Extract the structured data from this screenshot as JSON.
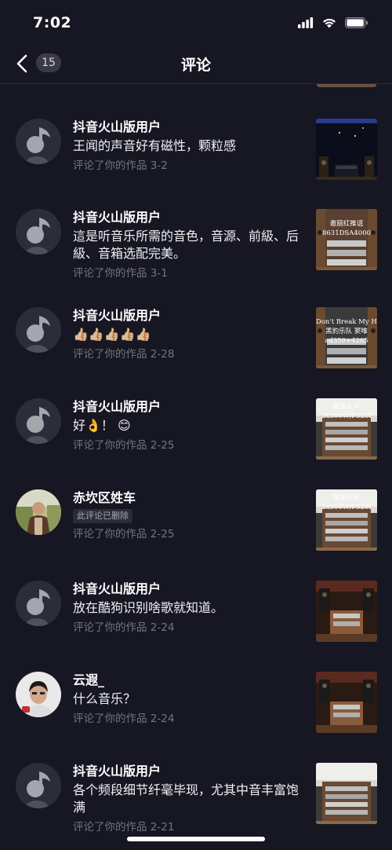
{
  "status": {
    "time": "7:02"
  },
  "nav": {
    "back_count": "15",
    "title": "评论"
  },
  "comments": [
    {
      "user": "抖音火山版用户",
      "text": "王闻的声音好有磁性，颗粒感",
      "meta": "评论了你的作品  3-2",
      "avatar": "default",
      "thumb": {
        "style": "dark-stage",
        "caption": []
      }
    },
    {
      "user": "抖音火山版用户",
      "text": "這是听音乐所需的音色，音源、前級、后級、音箱选配完美。",
      "meta": "评论了你的作品  3-1",
      "avatar": "default",
      "thumb": {
        "style": "rack",
        "caption": [
          "邀丽红推诅",
          "8631DSA4000"
        ]
      }
    },
    {
      "user": "抖音火山版用户",
      "text": "👍🏼👍🏼👍🏼👍🏼👍🏼",
      "meta": "评论了你的作品  2-28",
      "avatar": "default",
      "thumb": {
        "style": "rack-dark",
        "caption": [
          "Don't Break My Heart",
          "黑豹乐队 窦唯",
          "ad350+4265"
        ]
      }
    },
    {
      "user": "抖音火山版用户",
      "text": "好👌！ 😊",
      "meta": "评论了你的作品  2-25",
      "avatar": "default",
      "thumb": {
        "style": "room-light",
        "caption": [
          "甜美女声",
          "2x300W/F520I"
        ]
      }
    },
    {
      "user": "赤坎区姓车",
      "text": "",
      "deleted": "此评论已删除",
      "meta": "评论了你的作品  2-25",
      "avatar": "photo1",
      "thumb": {
        "style": "room-light",
        "caption": [
          "甜美女声",
          "2x300W/F520I"
        ]
      }
    },
    {
      "user": "抖音火山版用户",
      "text": "放在酷狗识别啥歌就知道。",
      "meta": "评论了你的作品  2-24",
      "avatar": "default",
      "thumb": {
        "style": "wood",
        "caption": []
      }
    },
    {
      "user": "云遐_",
      "text": "什么音乐？",
      "meta": "评论了你的作品  2-24",
      "avatar": "photo2",
      "thumb": {
        "style": "wood",
        "caption": []
      }
    },
    {
      "user": "抖音火山版用户",
      "text": "各个频段细节纤毫毕现，尤其中音丰富饱满",
      "meta": "评论了你的作品  2-21",
      "avatar": "default",
      "thumb": {
        "style": "room-light2",
        "caption": []
      }
    }
  ]
}
